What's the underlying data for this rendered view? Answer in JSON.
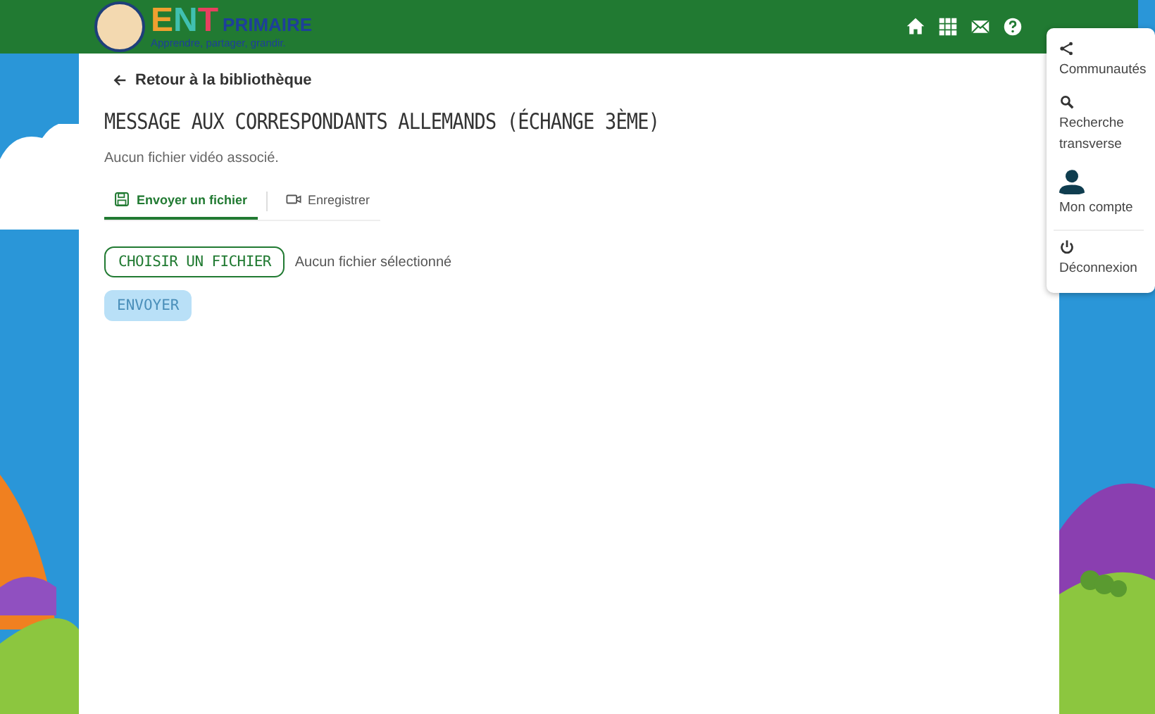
{
  "header": {
    "logo": {
      "letters": [
        {
          "text": "E",
          "color": "#f0a030"
        },
        {
          "text": "N",
          "color": "#40c0b0"
        },
        {
          "text": "T",
          "color": "#e84060"
        }
      ],
      "name": "PRIMAIRE",
      "tagline": "Apprendre, partager, grandir."
    },
    "icons": [
      {
        "kind": "home"
      },
      {
        "kind": "apps"
      },
      {
        "kind": "mail"
      },
      {
        "kind": "help"
      }
    ]
  },
  "menu": {
    "items": [
      {
        "kind": "share",
        "label": "Communautés"
      },
      {
        "kind": "search",
        "label": "Recherche transverse"
      },
      {
        "kind": "user",
        "label": "Mon compte"
      },
      {
        "kind": "power",
        "label": "Déconnexion"
      }
    ]
  },
  "back_link": "Retour à la bibliothèque",
  "title": "MESSAGE AUX CORRESPONDANTS ALLEMANDS (ÉCHANGE 3ÈME)",
  "subtitle": "Aucun fichier vidéo associé.",
  "tabs": [
    {
      "kind": "save",
      "label": "Envoyer un fichier",
      "selected": true
    },
    {
      "kind": "video",
      "label": "Enregistrer",
      "selected": false
    }
  ],
  "file_button": "CHOISIR UN FICHIER",
  "file_status": "Aucun fichier sélectionné",
  "send_button": {
    "label": "ENVOYER",
    "disabled": true
  }
}
